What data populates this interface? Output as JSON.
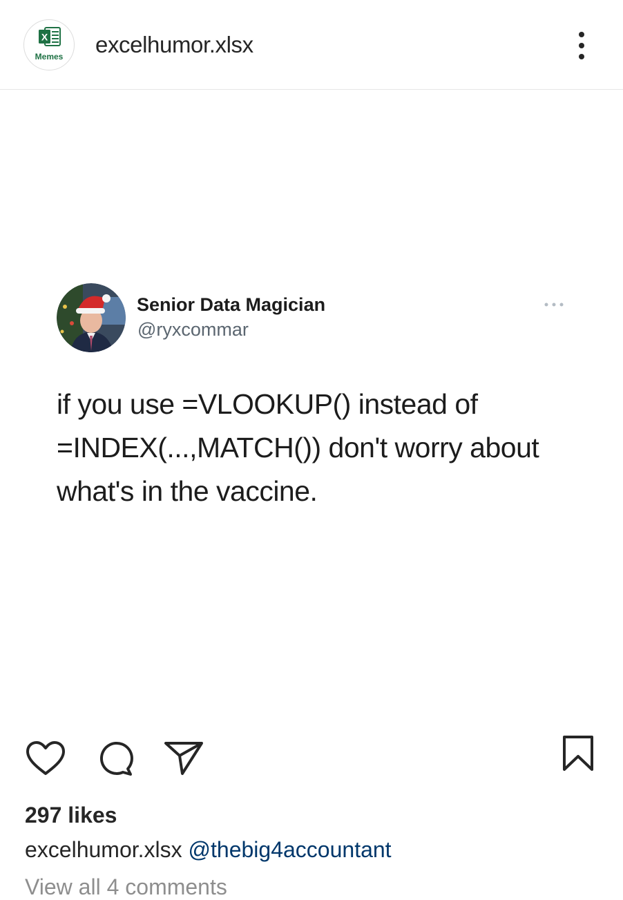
{
  "header": {
    "username": "excelhumor.xlsx",
    "avatar_label": "Memes",
    "avatar_logo_letter": "X",
    "menu_icon": "kebab-menu-icon",
    "accent_color": "#1e7144"
  },
  "post": {
    "tweet": {
      "display_name": "Senior Data Magician",
      "handle": "@ryxcommar",
      "more_icon": "ellipsis-icon",
      "text_lines": [
        "if you use =VLOOKUP() instead of",
        "=INDEX(...,MATCH()) don't worry about",
        "what's in the vaccine."
      ]
    }
  },
  "actions": {
    "like_icon": "heart-icon",
    "comment_icon": "comment-icon",
    "share_icon": "paper-plane-icon",
    "save_icon": "bookmark-icon"
  },
  "likes": "297 likes",
  "caption": {
    "username": "excelhumor.xlsx",
    "mention": "@thebig4accountant"
  },
  "view_comments": "View all 4 comments"
}
